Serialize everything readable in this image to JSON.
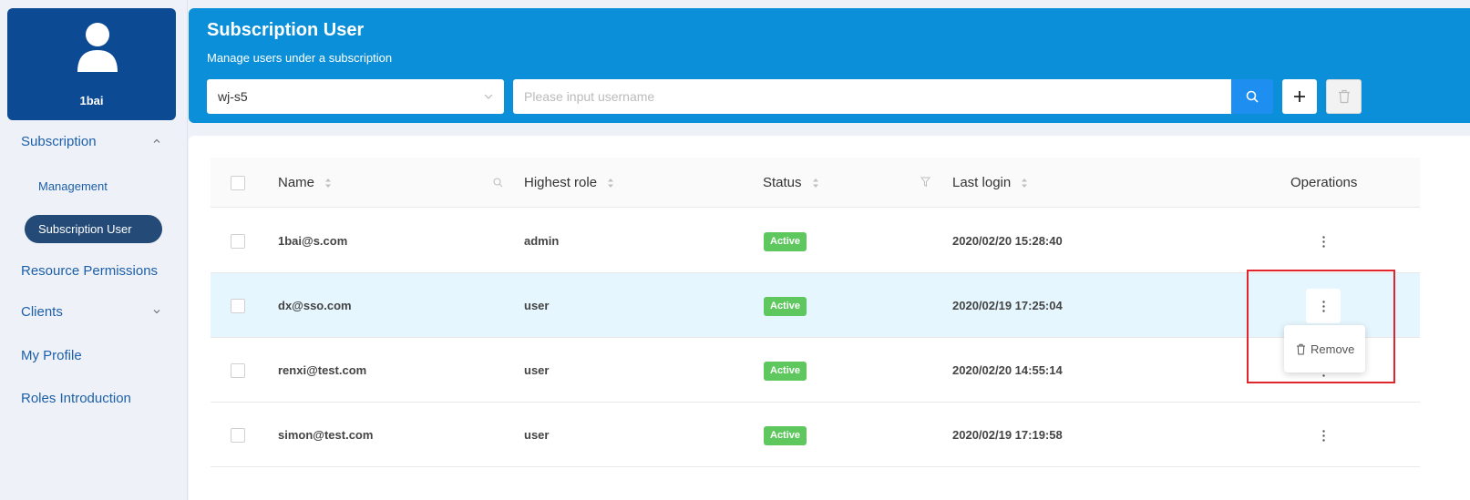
{
  "sidebar": {
    "profile_name": "1bai",
    "items": [
      {
        "label": "Subscription"
      },
      {
        "label": "Management"
      },
      {
        "label": "Subscription User"
      },
      {
        "label": "Resource Permissions"
      },
      {
        "label": "Clients"
      },
      {
        "label": "My Profile"
      },
      {
        "label": "Roles Introduction"
      }
    ]
  },
  "header": {
    "title": "Subscription User",
    "subtitle": "Manage users under a subscription",
    "subscription_select": "wj-s5",
    "search_placeholder": "Please input username"
  },
  "table": {
    "columns": [
      "Name",
      "Highest role",
      "Status",
      "Last login",
      "Operations"
    ],
    "rows": [
      {
        "name": "1bai@s.com",
        "role": "admin",
        "status": "Active",
        "last_login": "2020/02/20 15:28:40"
      },
      {
        "name": "dx@sso.com",
        "role": "user",
        "status": "Active",
        "last_login": "2020/02/19 17:25:04"
      },
      {
        "name": "renxi@test.com",
        "role": "user",
        "status": "Active",
        "last_login": "2020/02/20 14:55:14"
      },
      {
        "name": "simon@test.com",
        "role": "user",
        "status": "Active",
        "last_login": "2020/02/19 17:19:58"
      }
    ]
  },
  "dropdown": {
    "remove_label": "Remove"
  },
  "colors": {
    "brand_dark": "#0d4a94",
    "header_blue": "#0a8fd8",
    "active_green": "#5ec85e",
    "highlight_red": "#e0262c"
  }
}
